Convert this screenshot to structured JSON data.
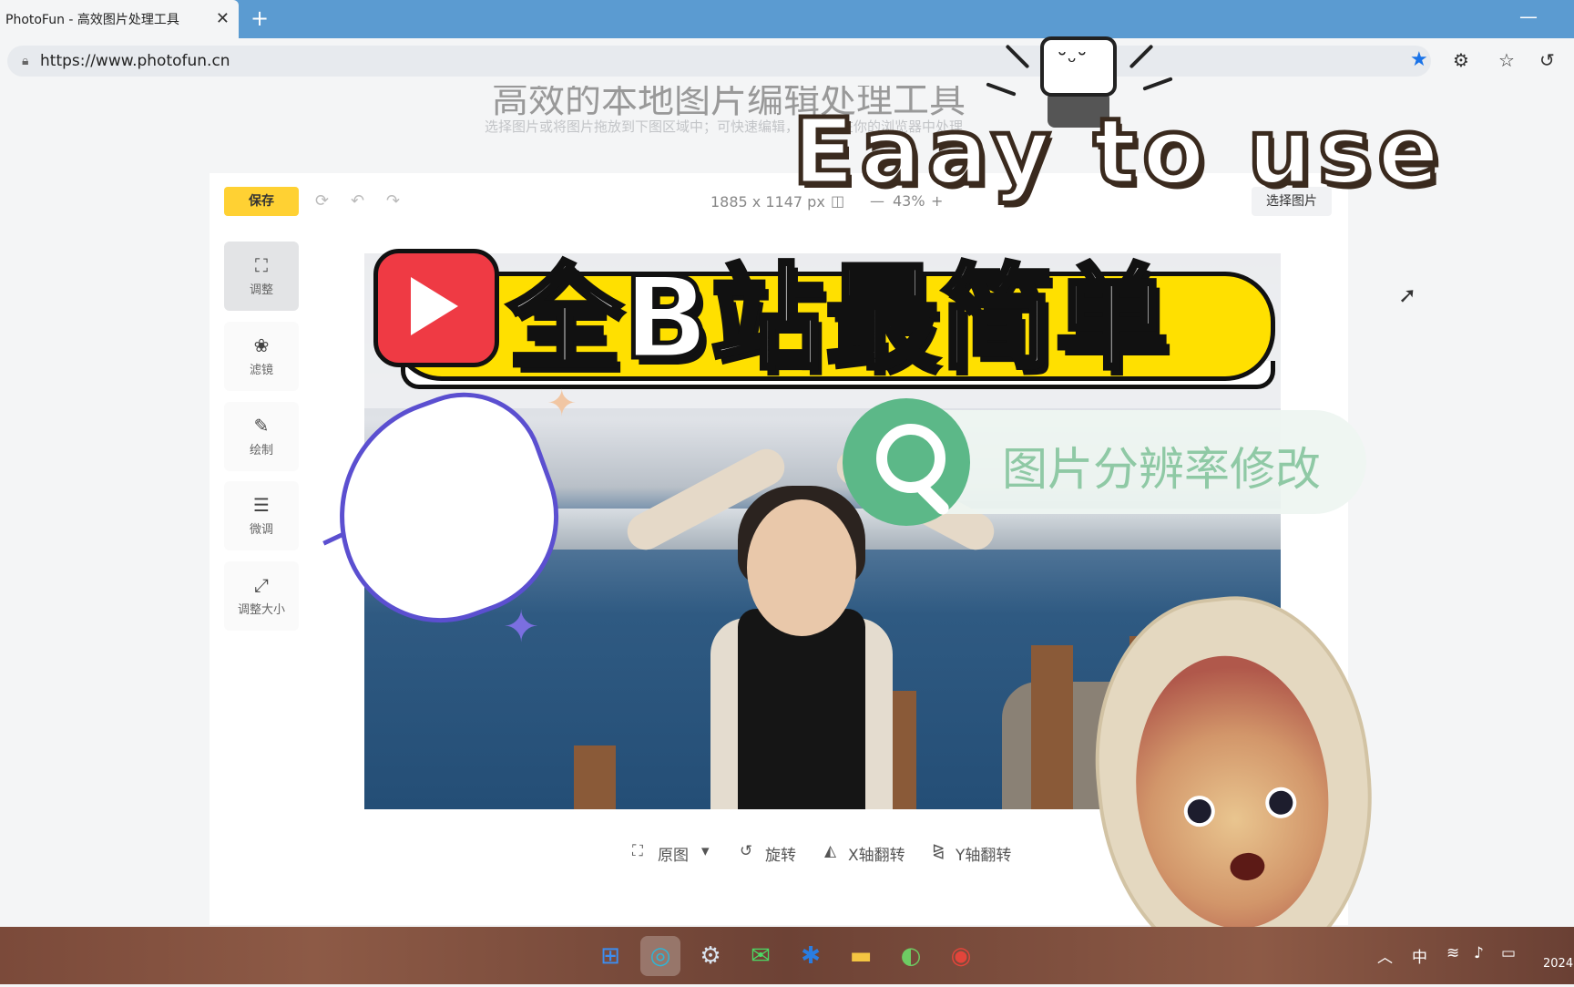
{
  "browser": {
    "tab_title": "PhotoFun - 高效图片处理工具",
    "tab_close": "✕",
    "new_tab": "+",
    "minimize": "—",
    "url": "https://www.photofun.cn"
  },
  "page": {
    "title": "高效的本地图片编辑处理工具",
    "subtitle": "选择图片或将图片拖放到下图区域中；可快速编辑，图片只在你的浏览器中处理"
  },
  "editor": {
    "save_label": "保存",
    "dimensions": "1885 x 1147 px",
    "zoom": "43%",
    "zoom_minus": "—",
    "zoom_plus": "+",
    "select_image_label": "选择图片",
    "sidebar": [
      {
        "label": "调整",
        "icon": "crop-icon",
        "glyph": "⛶"
      },
      {
        "label": "滤镜",
        "icon": "filter-icon",
        "glyph": "❀"
      },
      {
        "label": "绘制",
        "icon": "draw-icon",
        "glyph": "✎"
      },
      {
        "label": "微调",
        "icon": "sliders-icon",
        "glyph": "☰"
      },
      {
        "label": "调整大小",
        "icon": "resize-icon",
        "glyph": "⤢"
      }
    ],
    "bottom_tools": {
      "original": "原图",
      "rotate": "旋转",
      "flip_x": "X轴翻转",
      "flip_y": "Y轴翻转"
    }
  },
  "overlay": {
    "headline": "全B站最简单",
    "search_text": "图片分辨率修改",
    "easy_text": "Eaay to use"
  },
  "taskbar": {
    "ime": "中",
    "year": "2024"
  },
  "colors": {
    "tabbar": "#5b9bd1",
    "save_button": "#ffd133",
    "headline_bar": "#ffe000",
    "play_red": "#ef3a44",
    "search_green": "#5cb888"
  }
}
